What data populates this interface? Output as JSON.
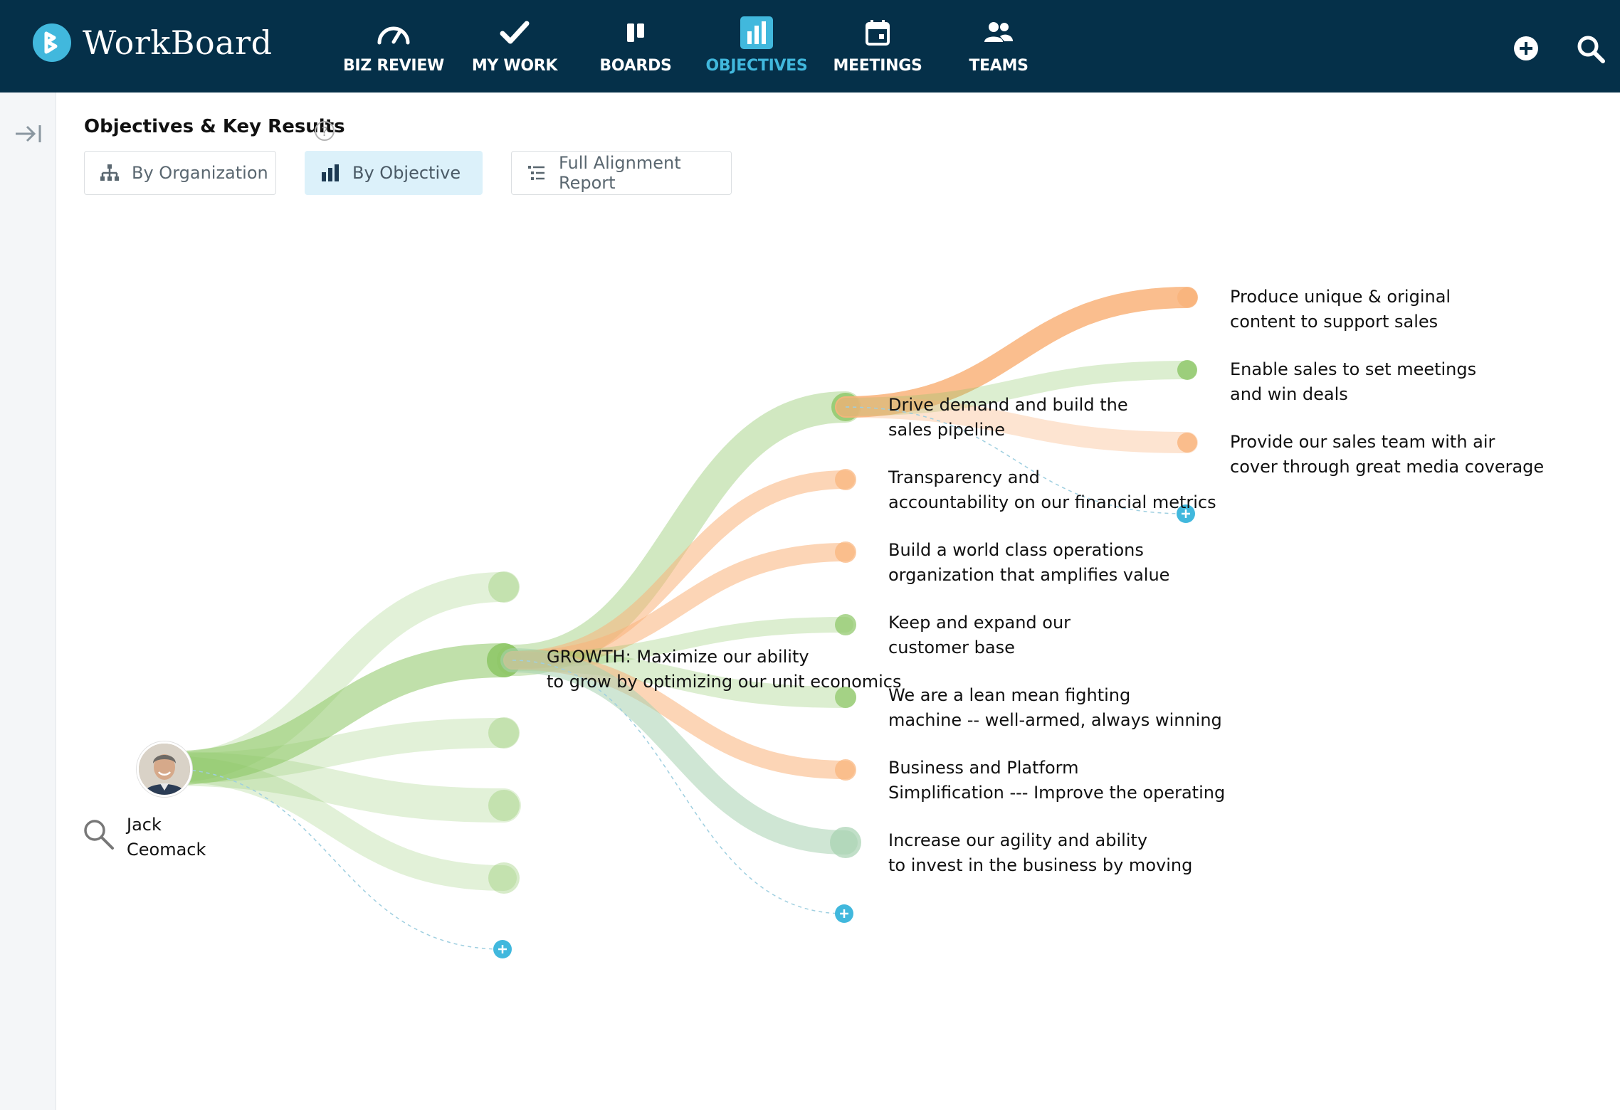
{
  "app": {
    "name": "WorkBoard"
  },
  "nav": {
    "items": [
      {
        "label": "BIZ REVIEW",
        "icon": "gauge-icon"
      },
      {
        "label": "MY WORK",
        "icon": "checkmark-icon"
      },
      {
        "label": "BOARDS",
        "icon": "boards-icon"
      },
      {
        "label": "OBJECTIVES",
        "icon": "bar-chart-icon",
        "active": true
      },
      {
        "label": "MEETINGS",
        "icon": "calendar-icon"
      },
      {
        "label": "TEAMS",
        "icon": "people-icon"
      }
    ],
    "actions": [
      "add-icon",
      "search-icon"
    ]
  },
  "page": {
    "title": "Objectives & Key Results",
    "help_icon": "?"
  },
  "views": [
    {
      "label": "By Organization",
      "icon": "org-chart-icon",
      "selected": false
    },
    {
      "label": "By Objective",
      "icon": "bar-chart-icon",
      "selected": true
    },
    {
      "label": "Full Alignment Report",
      "icon": "list-icon",
      "selected": false
    }
  ],
  "person": {
    "first": "Jack",
    "last": "Ceomack"
  },
  "level1": {
    "line1": "GROWTH: Maximize our ability",
    "line2": "to grow by optimizing our unit economics"
  },
  "level2": [
    {
      "line1": "Drive demand and build the",
      "line2": "sales pipeline",
      "status": "green"
    },
    {
      "line1": "Transparency and",
      "line2": "accountability on our financial metrics",
      "status": "orange"
    },
    {
      "line1": "Build a world class operations",
      "line2": "organization that amplifies value",
      "status": "orange"
    },
    {
      "line1": "Keep and expand our",
      "line2": "customer base",
      "status": "green"
    },
    {
      "line1": "We are a lean mean fighting",
      "line2": "machine -- well-armed, always winning",
      "status": "green"
    },
    {
      "line1": "Business and Platform",
      "line2": "Simplification --- Improve the operating",
      "status": "orange"
    },
    {
      "line1": "Increase our agility and ability",
      "line2": "to invest in the business by moving",
      "status": "teal"
    }
  ],
  "level3": [
    {
      "line1": "Produce unique & original",
      "line2": "content to support sales",
      "status": "orange"
    },
    {
      "line1": "Enable sales to set meetings",
      "line2": "and win deals",
      "status": "green"
    },
    {
      "line1": "Provide our sales team with air",
      "line2": "cover through great media coverage",
      "status": "orange"
    }
  ],
  "colors": {
    "topbar": "#053049",
    "accent": "#41b8dd",
    "green": "#8cc665",
    "green_light": "#cfe6bd",
    "orange": "#f9b37a",
    "orange_light": "#fcdcc3",
    "teal": "#a7d2b0",
    "add_node": "#41b8dd"
  }
}
